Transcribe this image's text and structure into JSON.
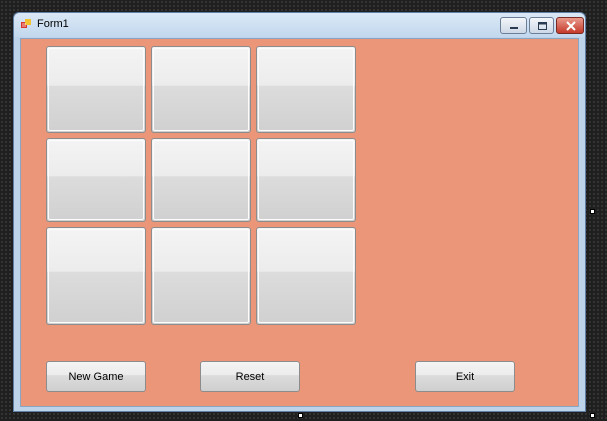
{
  "window": {
    "title": "Form1",
    "icon": "form-app-icon",
    "controls": [
      "minimize-icon",
      "maximize-icon",
      "close-icon"
    ]
  },
  "form": {
    "background_color": "#eb9679",
    "board_cells": [
      "",
      "",
      "",
      "",
      "",
      "",
      "",
      "",
      ""
    ]
  },
  "buttons": {
    "new_game": "New Game",
    "reset": "Reset",
    "exit": "Exit"
  }
}
